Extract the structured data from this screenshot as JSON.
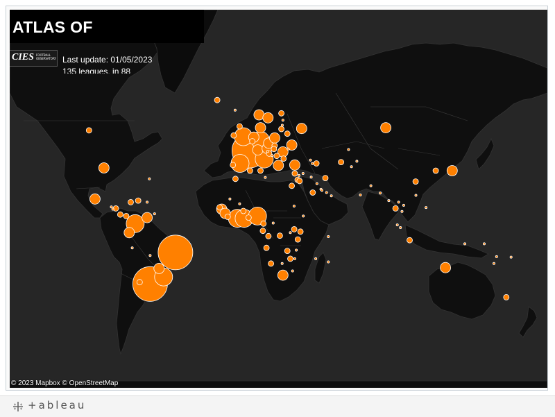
{
  "viz": {
    "title": "ATLAS OF",
    "logo_text": "CIES",
    "logo_subtext": "FOOTBALL OBSERVATORY",
    "update_line": "Last update: 01/05/2023",
    "leagues_line": "135 leagues, in 88",
    "attribution_mapbox": "© 2023 Mapbox",
    "attribution_osm": "© OpenStreetMap"
  },
  "footer": {
    "brand": "+ableau"
  },
  "colors": {
    "map_background": "#262626",
    "land": "#0f0f0f",
    "bubble": "#ff8000",
    "bubble_outline": "#ffffff"
  },
  "map": {
    "projection": "web-mercator-like",
    "legend": "none",
    "bubbles": [
      {
        "region": "Argentina",
        "lon": -64,
        "lat": -34,
        "size": "very-large"
      },
      {
        "region": "Brazil",
        "lon": -47,
        "lat": -15,
        "size": "very-large"
      },
      {
        "region": "Uruguay/South Brazil",
        "lon": -55,
        "lat": -30,
        "size": "large"
      },
      {
        "region": "Chile",
        "lon": -71,
        "lat": -33,
        "size": "small"
      },
      {
        "region": "Paraguay",
        "lon": -58,
        "lat": -25,
        "size": "medium"
      },
      {
        "region": "Bolivia",
        "lon": -64,
        "lat": -17,
        "size": "tiny"
      },
      {
        "region": "Peru",
        "lon": -76,
        "lat": -12,
        "size": "tiny"
      },
      {
        "region": "Ecuador",
        "lon": -78,
        "lat": -2,
        "size": "medium"
      },
      {
        "region": "Colombia",
        "lon": -74,
        "lat": 4,
        "size": "large"
      },
      {
        "region": "Venezuela",
        "lon": -66,
        "lat": 8,
        "size": "medium"
      },
      {
        "region": "Panama",
        "lon": -80,
        "lat": 9,
        "size": "small"
      },
      {
        "region": "Costa Rica",
        "lon": -84,
        "lat": 10,
        "size": "small"
      },
      {
        "region": "Honduras",
        "lon": -87,
        "lat": 14,
        "size": "small"
      },
      {
        "region": "Guatemala",
        "lon": -90,
        "lat": 15,
        "size": "tiny"
      },
      {
        "region": "El Salvador",
        "lon": -89,
        "lat": 13.5,
        "size": "tiny"
      },
      {
        "region": "Jamaica",
        "lon": -77,
        "lat": 18,
        "size": "small"
      },
      {
        "region": "Cuba/Haiti",
        "lon": -72,
        "lat": 19,
        "size": "small"
      },
      {
        "region": "Puerto Rico",
        "lon": -66,
        "lat": 18,
        "size": "tiny"
      },
      {
        "region": "Trinidad",
        "lon": -61,
        "lat": 10.5,
        "size": "tiny"
      },
      {
        "region": "Mexico",
        "lon": -101,
        "lat": 20,
        "size": "medium"
      },
      {
        "region": "USA",
        "lon": -95,
        "lat": 38,
        "size": "medium"
      },
      {
        "region": "Canada",
        "lon": -105,
        "lat": 55,
        "size": "small"
      },
      {
        "region": "Bermuda",
        "lon": -64.5,
        "lat": 32,
        "size": "tiny"
      },
      {
        "region": "Iceland",
        "lon": -19,
        "lat": 65,
        "size": "small"
      },
      {
        "region": "Faroe",
        "lon": -7,
        "lat": 62,
        "size": "tiny"
      },
      {
        "region": "Norway",
        "lon": 9,
        "lat": 60.5,
        "size": "medium"
      },
      {
        "region": "Sweden",
        "lon": 15,
        "lat": 59.5,
        "size": "medium"
      },
      {
        "region": "Finland",
        "lon": 24,
        "lat": 61,
        "size": "small"
      },
      {
        "region": "Denmark",
        "lon": 10,
        "lat": 56,
        "size": "medium"
      },
      {
        "region": "Scotland",
        "lon": -4,
        "lat": 56.5,
        "size": "small"
      },
      {
        "region": "England",
        "lon": -1.5,
        "lat": 52.5,
        "size": "large"
      },
      {
        "region": "Ireland",
        "lon": -8,
        "lat": 53,
        "size": "small"
      },
      {
        "region": "Netherlands",
        "lon": 5.5,
        "lat": 52.3,
        "size": "medium"
      },
      {
        "region": "Belgium",
        "lon": 4.5,
        "lat": 50.6,
        "size": "small"
      },
      {
        "region": "Germany",
        "lon": 10,
        "lat": 51,
        "size": "large"
      },
      {
        "region": "France",
        "lon": 2.5,
        "lat": 46.5,
        "size": "very-large"
      },
      {
        "region": "Spain",
        "lon": -3.7,
        "lat": 40.3,
        "size": "large"
      },
      {
        "region": "Portugal",
        "lon": -8.5,
        "lat": 39.5,
        "size": "small"
      },
      {
        "region": "Italy",
        "lon": 12.5,
        "lat": 42.5,
        "size": "large"
      },
      {
        "region": "Switzerland",
        "lon": 8.2,
        "lat": 46.8,
        "size": "medium"
      },
      {
        "region": "Austria",
        "lon": 14.5,
        "lat": 47.5,
        "size": "medium"
      },
      {
        "region": "Czechia",
        "lon": 15.5,
        "lat": 49.8,
        "size": "medium"
      },
      {
        "region": "Poland",
        "lon": 19.5,
        "lat": 52,
        "size": "medium"
      },
      {
        "region": "Lithuania",
        "lon": 24,
        "lat": 55.5,
        "size": "small"
      },
      {
        "region": "Latvia",
        "lon": 24.6,
        "lat": 56.9,
        "size": "tiny"
      },
      {
        "region": "Estonia",
        "lon": 25,
        "lat": 58.7,
        "size": "tiny"
      },
      {
        "region": "Belarus",
        "lon": 28,
        "lat": 53.7,
        "size": "small"
      },
      {
        "region": "Ukraine",
        "lon": 31,
        "lat": 49,
        "size": "medium"
      },
      {
        "region": "Russia West",
        "lon": 37.6,
        "lat": 55.7,
        "size": "medium"
      },
      {
        "region": "Slovakia",
        "lon": 19.5,
        "lat": 48.7,
        "size": "small"
      },
      {
        "region": "Hungary",
        "lon": 19,
        "lat": 47.2,
        "size": "small"
      },
      {
        "region": "Romania",
        "lon": 25,
        "lat": 45.9,
        "size": "medium"
      },
      {
        "region": "Moldova",
        "lon": 28.5,
        "lat": 47.2,
        "size": "tiny"
      },
      {
        "region": "Bulgaria",
        "lon": 25.5,
        "lat": 42.7,
        "size": "small"
      },
      {
        "region": "Serbia",
        "lon": 20.9,
        "lat": 44,
        "size": "small"
      },
      {
        "region": "Croatia",
        "lon": 15.8,
        "lat": 45.1,
        "size": "small"
      },
      {
        "region": "Slovenia",
        "lon": 14.8,
        "lat": 46.1,
        "size": "tiny"
      },
      {
        "region": "Bosnia",
        "lon": 17.8,
        "lat": 44.2,
        "size": "tiny"
      },
      {
        "region": "Greece",
        "lon": 22,
        "lat": 39.3,
        "size": "medium"
      },
      {
        "region": "Cyprus",
        "lon": 33,
        "lat": 35,
        "size": "small"
      },
      {
        "region": "Turkey",
        "lon": 33,
        "lat": 39.5,
        "size": "medium"
      },
      {
        "region": "Georgia",
        "lon": 43.5,
        "lat": 42,
        "size": "tiny"
      },
      {
        "region": "Armenia",
        "lon": 44.8,
        "lat": 40.2,
        "size": "tiny"
      },
      {
        "region": "Azerbaijan",
        "lon": 47.5,
        "lat": 40.3,
        "size": "small"
      },
      {
        "region": "Kazakhstan",
        "lon": 69,
        "lat": 47,
        "size": "tiny"
      },
      {
        "region": "Russia East",
        "lon": 94,
        "lat": 56,
        "size": "medium"
      },
      {
        "region": "Uzbekistan",
        "lon": 64,
        "lat": 41,
        "size": "small"
      },
      {
        "region": "Kyrgyzstan",
        "lon": 74.6,
        "lat": 41.4,
        "size": "tiny"
      },
      {
        "region": "Tajikistan",
        "lon": 71,
        "lat": 38.6,
        "size": "tiny"
      },
      {
        "region": "Iran",
        "lon": 53.5,
        "lat": 32.5,
        "size": "small"
      },
      {
        "region": "Iraq",
        "lon": 44,
        "lat": 33,
        "size": "tiny"
      },
      {
        "region": "Syria",
        "lon": 38.5,
        "lat": 35,
        "size": "tiny"
      },
      {
        "region": "Lebanon",
        "lon": 35.8,
        "lat": 33.9,
        "size": "tiny"
      },
      {
        "region": "Israel",
        "lon": 34.9,
        "lat": 31.5,
        "size": "small"
      },
      {
        "region": "Jordan",
        "lon": 36.2,
        "lat": 30.8,
        "size": "small"
      },
      {
        "region": "Kuwait",
        "lon": 47.8,
        "lat": 29.3,
        "size": "tiny"
      },
      {
        "region": "Saudi Arabia",
        "lon": 45,
        "lat": 24,
        "size": "small"
      },
      {
        "region": "Bahrain",
        "lon": 50.5,
        "lat": 26,
        "size": "tiny"
      },
      {
        "region": "Qatar",
        "lon": 51.2,
        "lat": 25.3,
        "size": "tiny"
      },
      {
        "region": "UAE",
        "lon": 54.3,
        "lat": 24,
        "size": "tiny"
      },
      {
        "region": "Oman",
        "lon": 57.5,
        "lat": 22,
        "size": "tiny"
      },
      {
        "region": "India",
        "lon": 77,
        "lat": 22.5,
        "size": "tiny"
      },
      {
        "region": "Bangladesh",
        "lon": 90.3,
        "lat": 23.7,
        "size": "tiny"
      },
      {
        "region": "Nepal",
        "lon": 84,
        "lat": 28,
        "size": "tiny"
      },
      {
        "region": "Myanmar",
        "lon": 96,
        "lat": 19,
        "size": "tiny"
      },
      {
        "region": "Thailand",
        "lon": 100.5,
        "lat": 14,
        "size": "small"
      },
      {
        "region": "Cambodia",
        "lon": 104.9,
        "lat": 12,
        "size": "tiny"
      },
      {
        "region": "Vietnam",
        "lon": 106,
        "lat": 16,
        "size": "tiny"
      },
      {
        "region": "Laos",
        "lon": 102.6,
        "lat": 18,
        "size": "tiny"
      },
      {
        "region": "Malaysia",
        "lon": 101.7,
        "lat": 3.2,
        "size": "tiny"
      },
      {
        "region": "Singapore",
        "lon": 103.8,
        "lat": 1.4,
        "size": "tiny"
      },
      {
        "region": "Indonesia",
        "lon": 110,
        "lat": -7,
        "size": "small"
      },
      {
        "region": "Philippines",
        "lon": 121,
        "lat": 14.6,
        "size": "tiny"
      },
      {
        "region": "China",
        "lon": 114,
        "lat": 30.5,
        "size": "small"
      },
      {
        "region": "Hong Kong",
        "lon": 114.2,
        "lat": 22.3,
        "size": "tiny"
      },
      {
        "region": "South Korea",
        "lon": 127.5,
        "lat": 36.5,
        "size": "small"
      },
      {
        "region": "Japan",
        "lon": 138.5,
        "lat": 36.5,
        "size": "medium"
      },
      {
        "region": "Australia",
        "lon": 134,
        "lat": -24.5,
        "size": "medium"
      },
      {
        "region": "New Zealand",
        "lon": 174.8,
        "lat": -41,
        "size": "small"
      },
      {
        "region": "Papua New Guinea",
        "lon": 147,
        "lat": -9.4,
        "size": "tiny"
      },
      {
        "region": "Solomon Islands",
        "lon": 160,
        "lat": -9.4,
        "size": "tiny"
      },
      {
        "region": "Vanuatu",
        "lon": 168.3,
        "lat": -17.7,
        "size": "tiny"
      },
      {
        "region": "New Caledonia",
        "lon": 166.5,
        "lat": -22,
        "size": "tiny"
      },
      {
        "region": "Fiji",
        "lon": 178,
        "lat": -18,
        "size": "tiny"
      },
      {
        "region": "Morocco",
        "lon": -6.8,
        "lat": 32,
        "size": "small"
      },
      {
        "region": "Algeria",
        "lon": 3,
        "lat": 36.5,
        "size": "small"
      },
      {
        "region": "Tunisia",
        "lon": 10,
        "lat": 36.5,
        "size": "small"
      },
      {
        "region": "Libya",
        "lon": 13.2,
        "lat": 32.8,
        "size": "tiny"
      },
      {
        "region": "Egypt",
        "lon": 31,
        "lat": 28,
        "size": "small"
      },
      {
        "region": "Sudan",
        "lon": 32.5,
        "lat": 15.5,
        "size": "tiny"
      },
      {
        "region": "Mali",
        "lon": -4,
        "lat": 17,
        "size": "tiny"
      },
      {
        "region": "Mauritania",
        "lon": -10.5,
        "lat": 20,
        "size": "tiny"
      },
      {
        "region": "Senegal",
        "lon": -17.4,
        "lat": 14.7,
        "size": "small"
      },
      {
        "region": "Gambia",
        "lon": -16,
        "lat": 13.5,
        "size": "medium"
      },
      {
        "region": "Guinea",
        "lon": -13.7,
        "lat": 10.8,
        "size": "medium"
      },
      {
        "region": "Sierra Leone",
        "lon": -12,
        "lat": 8.5,
        "size": "small"
      },
      {
        "region": "Ivory Coast",
        "lon": -5.5,
        "lat": 7.5,
        "size": "large"
      },
      {
        "region": "Ghana",
        "lon": -1,
        "lat": 7.5,
        "size": "large"
      },
      {
        "region": "Burkina Faso",
        "lon": -1.5,
        "lat": 12.4,
        "size": "small"
      },
      {
        "region": "Togo/Benin",
        "lon": 2,
        "lat": 8,
        "size": "small"
      },
      {
        "region": "Nigeria",
        "lon": 8,
        "lat": 9,
        "size": "large"
      },
      {
        "region": "Cameroon",
        "lon": 12,
        "lat": 4,
        "size": "small"
      },
      {
        "region": "Gabon",
        "lon": 11.6,
        "lat": -0.8,
        "size": "small"
      },
      {
        "region": "Congo",
        "lon": 15.3,
        "lat": -4.3,
        "size": "small"
      },
      {
        "region": "Central African Rep.",
        "lon": 18.5,
        "lat": 4.4,
        "size": "tiny"
      },
      {
        "region": "Ethiopia",
        "lon": 38.7,
        "lat": 9,
        "size": "tiny"
      },
      {
        "region": "Uganda",
        "lon": 32.6,
        "lat": 0.3,
        "size": "small"
      },
      {
        "region": "Rwanda",
        "lon": 30,
        "lat": -2,
        "size": "tiny"
      },
      {
        "region": "Kenya",
        "lon": 36.8,
        "lat": -1.3,
        "size": "small"
      },
      {
        "region": "Tanzania",
        "lon": 35,
        "lat": -6.5,
        "size": "small"
      },
      {
        "region": "DR Congo",
        "lon": 23,
        "lat": -4,
        "size": "small"
      },
      {
        "region": "Angola",
        "lon": 14,
        "lat": -12,
        "size": "small"
      },
      {
        "region": "Zambia",
        "lon": 28,
        "lat": -14,
        "size": "small"
      },
      {
        "region": "Malawi",
        "lon": 34,
        "lat": -13.5,
        "size": "tiny"
      },
      {
        "region": "Zimbabwe",
        "lon": 30,
        "lat": -19,
        "size": "small"
      },
      {
        "region": "Mozambique",
        "lon": 33,
        "lat": -19,
        "size": "tiny"
      },
      {
        "region": "Botswana",
        "lon": 24.5,
        "lat": -22,
        "size": "tiny"
      },
      {
        "region": "Namibia",
        "lon": 17,
        "lat": -22,
        "size": "small"
      },
      {
        "region": "Eswatini",
        "lon": 31.5,
        "lat": -26.5,
        "size": "tiny"
      },
      {
        "region": "South Africa",
        "lon": 25,
        "lat": -29,
        "size": "medium"
      },
      {
        "region": "Madagascar",
        "lon": 47,
        "lat": -19,
        "size": "tiny"
      },
      {
        "region": "Mauritius/Reunion",
        "lon": 55.5,
        "lat": -21,
        "size": "tiny"
      },
      {
        "region": "Seychelles",
        "lon": 55.5,
        "lat": -4.6,
        "size": "tiny"
      }
    ]
  }
}
